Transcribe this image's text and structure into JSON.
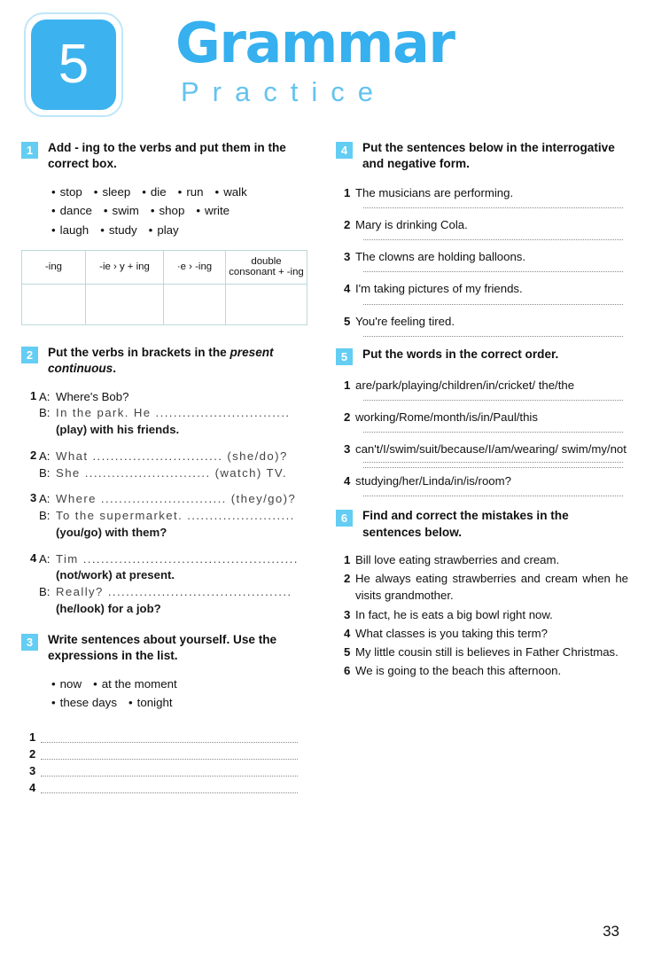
{
  "header": {
    "unit_number": "5",
    "title_main": "Grammar",
    "title_sub": "Practice",
    "accent_color": "#36b0ee",
    "badge_color": "#3cb3ef",
    "sub_color": "#63c3ef"
  },
  "page_number": "33",
  "exercise1": {
    "number": "1",
    "instruction": "Add - ing to the verbs and put them in the correct box.",
    "word_rows": [
      [
        "stop",
        "sleep",
        "die",
        "run",
        "walk"
      ],
      [
        "dance",
        "swim",
        "shop",
        "write"
      ],
      [
        "laugh",
        "study",
        "play"
      ]
    ],
    "table_headers": [
      "-ing",
      "-ie › y + ing",
      "·e › -ing",
      "double consonant + -ing"
    ],
    "table_header_4_line1": "double",
    "table_header_4_line2": "consonant + -ing"
  },
  "exercise2": {
    "number": "2",
    "instruction_part1": "Put the verbs in brackets in the ",
    "instruction_italic": "present continuous",
    "instruction_end": ".",
    "items": [
      {
        "n": "1",
        "lines": [
          {
            "speaker": "A:",
            "text": "Where's Bob?"
          },
          {
            "speaker": "B:",
            "text": "In the park. He .............................."
          },
          {
            "speaker": "",
            "text": "(play) with his friends.",
            "bold_prefix": "(play)",
            "rest": " with his friends."
          }
        ]
      },
      {
        "n": "2",
        "lines": [
          {
            "speaker": "A:",
            "text": "What ............................. (she/do)?"
          },
          {
            "speaker": "B:",
            "text": "She  ............................ (watch) TV."
          }
        ]
      },
      {
        "n": "3",
        "lines": [
          {
            "speaker": "A:",
            "text": "Where ............................ (they/go)?"
          },
          {
            "speaker": "B:",
            "text": "To the supermarket. ........................"
          },
          {
            "speaker": "",
            "text": "(you/go) with them?"
          }
        ]
      },
      {
        "n": "4",
        "lines": [
          {
            "speaker": "A:",
            "text": "Tim ................................................"
          },
          {
            "speaker": "",
            "text": "(not/work) at present."
          },
          {
            "speaker": "B:",
            "text": "Really? ........................................."
          },
          {
            "speaker": "",
            "text": "(he/look) for a job?"
          }
        ]
      }
    ]
  },
  "exercise3": {
    "number": "3",
    "instruction": "Write sentences about yourself. Use the expressions in the list.",
    "word_rows": [
      [
        "now",
        "at the moment"
      ],
      [
        "these days",
        "tonight"
      ]
    ],
    "answer_numbers": [
      "1",
      "2",
      "3",
      "4"
    ]
  },
  "exercise4": {
    "number": "4",
    "instruction": "Put the sentences below in the interrogative and negative form.",
    "items": [
      {
        "n": "1",
        "text": "The musicians are performing."
      },
      {
        "n": "2",
        "text": "Mary is drinking Cola."
      },
      {
        "n": "3",
        "text": "The clowns are holding balloons."
      },
      {
        "n": "4",
        "text": "I'm taking pictures of my friends."
      },
      {
        "n": "5",
        "text": "You're feeling tired."
      }
    ]
  },
  "exercise5": {
    "number": "5",
    "instruction": "Put the words in the correct order.",
    "items": [
      {
        "n": "1",
        "text": "are/park/playing/children/in/cricket/ the/the",
        "rules": 1
      },
      {
        "n": "2",
        "text": "working/Rome/month/is/in/Paul/this",
        "rules": 1
      },
      {
        "n": "3",
        "text": "can't/I/swim/suit/because/I/am/wearing/ swim/my/not",
        "rules": 2
      },
      {
        "n": "4",
        "text": "studying/her/Linda/in/is/room?",
        "rules": 1
      }
    ]
  },
  "exercise6": {
    "number": "6",
    "instruction": "Find and correct the mistakes in the sentences below.",
    "items": [
      {
        "n": "1",
        "text": "Bill love eating strawberries and cream."
      },
      {
        "n": "2",
        "text": "He always eating strawberries and cream when he visits grandmother."
      },
      {
        "n": "3",
        "text": "In fact, he is eats a big bowl right now."
      },
      {
        "n": "4",
        "text": "What classes is you taking this term?"
      },
      {
        "n": "5",
        "text": "My little cousin still is believes in Father Christmas."
      },
      {
        "n": "6",
        "text": "We is going to the beach this afternoon."
      }
    ]
  }
}
